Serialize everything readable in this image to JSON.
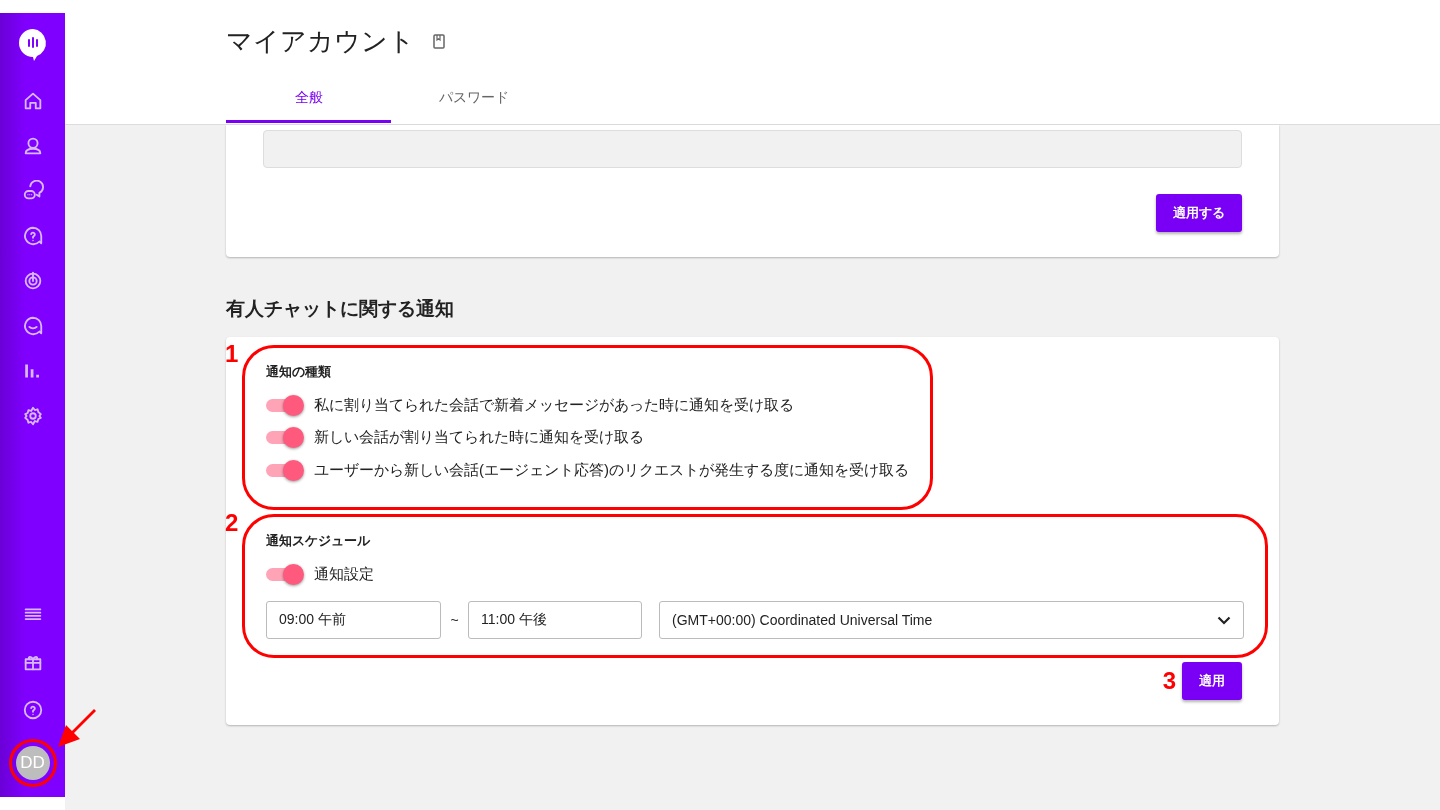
{
  "sidebar": {
    "avatar_initials": "DD"
  },
  "header": {
    "title": "マイアカウント"
  },
  "tabs": [
    {
      "label": "全般",
      "selected": true
    },
    {
      "label": "パスワード",
      "selected": false
    }
  ],
  "profile_card": {
    "button": "適用する"
  },
  "section_title": "有人チャットに関する通知",
  "notification_types": {
    "title": "通知の種類",
    "toggles": [
      {
        "label": "私に割り当てられた会話で新着メッセージがあった時に通知を受け取る",
        "on": true
      },
      {
        "label": "新しい会話が割り当てられた時に通知を受け取る",
        "on": true
      },
      {
        "label": "ユーザーから新しい会話(エージェント応答)のリクエストが発生する度に通知を受け取る",
        "on": true
      }
    ]
  },
  "schedule": {
    "title": "通知スケジュール",
    "toggle": {
      "label": "通知設定",
      "on": true
    },
    "start_time": "09:00 午前",
    "separator": "~",
    "end_time": "11:00 午後",
    "timezone": "(GMT+00:00) Coordinated Universal Time"
  },
  "apply_button": "適用",
  "annotations": [
    "1",
    "2",
    "3"
  ]
}
